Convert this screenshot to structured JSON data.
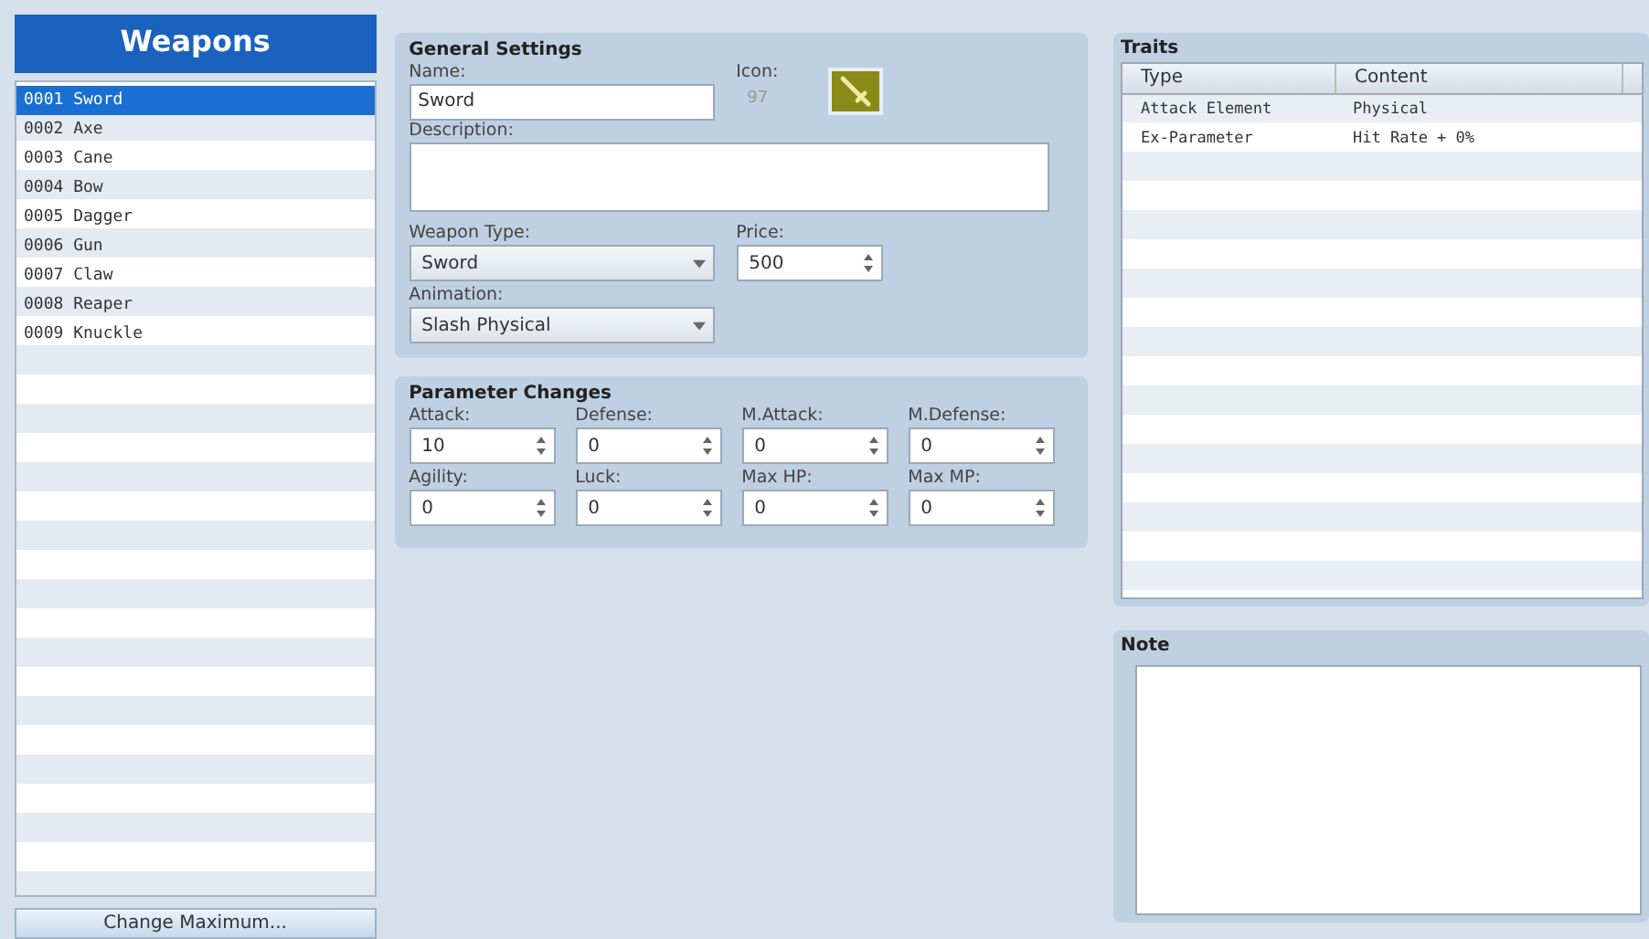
{
  "sidebar": {
    "title": "Weapons",
    "items": [
      {
        "label": "0001 Sword",
        "selected": true
      },
      {
        "label": "0002 Axe",
        "selected": false
      },
      {
        "label": "0003 Cane",
        "selected": false
      },
      {
        "label": "0004 Bow",
        "selected": false
      },
      {
        "label": "0005 Dagger",
        "selected": false
      },
      {
        "label": "0006 Gun",
        "selected": false
      },
      {
        "label": "0007 Claw",
        "selected": false
      },
      {
        "label": "0008 Reaper",
        "selected": false
      },
      {
        "label": "0009 Knuckle",
        "selected": false
      }
    ],
    "button": "Change Maximum..."
  },
  "general_settings": {
    "title": "General Settings",
    "name_label": "Name:",
    "name_value": "Sword",
    "icon_label": "Icon:",
    "icon_index": "97",
    "description_label": "Description:",
    "weapon_type_label": "Weapon Type:",
    "weapon_type_value": "Sword",
    "price_label": "Price:",
    "price_value": "500",
    "animation_label": "Animation:",
    "animation_value": "Slash Physical"
  },
  "parameter_changes": {
    "title": "Parameter Changes",
    "params": [
      {
        "label": "Attack:",
        "value": "10"
      },
      {
        "label": "Defense:",
        "value": "0"
      },
      {
        "label": "M.Attack:",
        "value": "0"
      },
      {
        "label": "M.Defense:",
        "value": "0"
      },
      {
        "label": "Agility:",
        "value": "0"
      },
      {
        "label": "Luck:",
        "value": "0"
      },
      {
        "label": "Max HP:",
        "value": "0"
      },
      {
        "label": "Max MP:",
        "value": "0"
      }
    ]
  },
  "traits": {
    "title": "Traits",
    "columns": [
      "Type",
      "Content"
    ],
    "rows": [
      [
        "Attack Element",
        "Physical"
      ],
      [
        "Ex-Parameter",
        "Hit Rate + 0%"
      ]
    ]
  },
  "note": {
    "title": "Note"
  }
}
